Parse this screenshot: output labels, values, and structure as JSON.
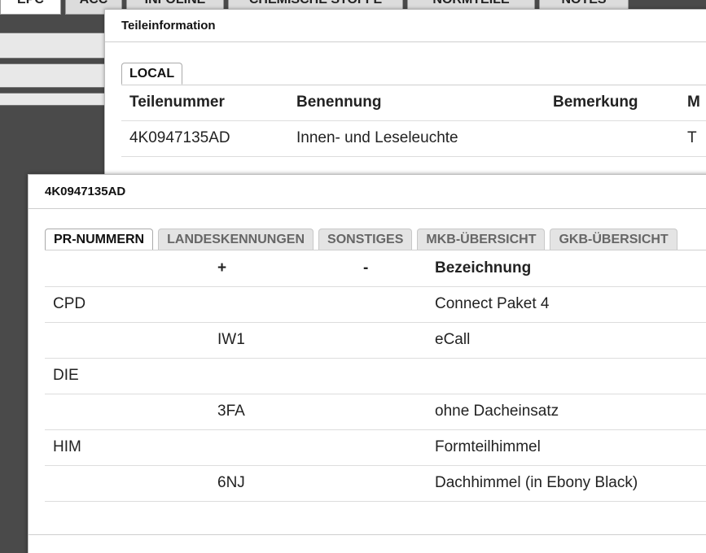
{
  "app_tabs": [
    "EPC",
    "ACC",
    "INFOLINE",
    "CHEMISCHE STOFFE",
    "NORMTEILE",
    "NOTES"
  ],
  "teileinformation": {
    "title": "Teileinformation",
    "tab": "LOCAL",
    "columns": [
      "Teilenummer",
      "Benennung",
      "Bemerkung",
      "M"
    ],
    "rows": [
      {
        "teilenummer": "4K0947135AD",
        "benennung": "Innen- und Leseleuchte",
        "bemerkung": "",
        "m": "T"
      }
    ]
  },
  "part_dialog": {
    "title": "4K0947135AD",
    "tabs": [
      "PR-NUMMERN",
      "LANDESKENNUNGEN",
      "SONSTIGES",
      "MKB-ÜBERSICHT",
      "GKB-ÜBERSICHT"
    ],
    "active_tab": "PR-NUMMERN",
    "columns": [
      "",
      "+",
      "-",
      "Bezeichnung"
    ],
    "rows": [
      {
        "family": "CPD",
        "plus": "",
        "minus": "",
        "bezeichnung": "Connect Paket 4"
      },
      {
        "family": "",
        "plus": "IW1",
        "minus": "",
        "bezeichnung": "eCall"
      },
      {
        "family": "DIE",
        "plus": "",
        "minus": "",
        "bezeichnung": ""
      },
      {
        "family": "",
        "plus": "3FA",
        "minus": "",
        "bezeichnung": "ohne Dacheinsatz"
      },
      {
        "family": "HIM",
        "plus": "",
        "minus": "",
        "bezeichnung": "Formteilhimmel"
      },
      {
        "family": "",
        "plus": "6NJ",
        "minus": "",
        "bezeichnung": "Dachhimmel (in Ebony Black)"
      }
    ]
  }
}
